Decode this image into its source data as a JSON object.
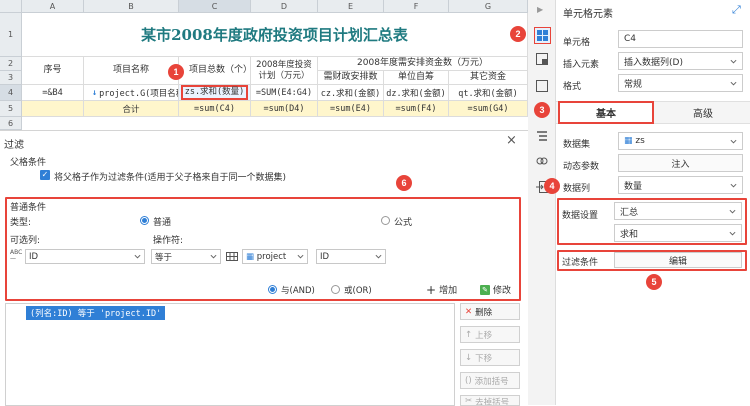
{
  "sheet": {
    "col_headers": [
      "A",
      "B",
      "C",
      "D",
      "E",
      "F",
      "G"
    ],
    "row_headers": [
      "1",
      "2",
      "3",
      "4",
      "5",
      "6"
    ],
    "title": "某市2008年度政府投资项目计划汇总表",
    "h_seq": "序号",
    "h_name": "项目名称",
    "h_total": "项目总数（个）",
    "h_plan": "2008年度投资计划（万元）",
    "h_arrange": "2008年度需安排资金数（万元）",
    "h_fiscal": "需财政安排数",
    "h_self": "单位自筹",
    "h_other": "其它资金",
    "r4_a": "=&B4",
    "r4_b": "project.G(项目名称)",
    "r4_c": "zs.求和(数量)",
    "r4_d": "=SUM(E4:G4)",
    "r4_e": "cz.求和(金额)",
    "r4_f": "dz.求和(金额)",
    "r4_g": "qt.求和(金额)",
    "r5_b": "合计",
    "r5_c": "=sum(C4)",
    "r5_d": "=sum(D4)",
    "r5_e": "=sum(E4)",
    "r5_f": "=sum(F4)",
    "r5_g": "=sum(G4)"
  },
  "callouts": [
    "1",
    "2",
    "3",
    "4",
    "5",
    "6"
  ],
  "dialog": {
    "title": "过滤",
    "parent_section": "父格条件",
    "parent_checkbox": "将父格子作为过滤条件(适用于父子格来自于同一个数据集)",
    "common_section": "普通条件",
    "type_label": "类型:",
    "type_normal": "普通",
    "type_formula": "公式",
    "optional_col_label": "可选列:",
    "operator_label": "操作符:",
    "col_value": "ID",
    "operator_value": "等于",
    "dataset_value": "project",
    "dataset_col_value": "ID",
    "logic_and": "与(AND)",
    "logic_or": "或(OR)",
    "add_button": "增加",
    "modify_button": "修改",
    "condition_text": "(列名:ID) 等于 'project.ID'",
    "delete_button": "删除",
    "up_button": "上移",
    "down_button": "下移",
    "add_bracket_button": "添加括号",
    "remove_bracket_button": "去掉括号"
  },
  "panel": {
    "title": "单元格元素",
    "cell_label": "单元格",
    "cell_value": "C4",
    "insert_label": "插入元素",
    "insert_value": "插入数据列(D)",
    "format_label": "格式",
    "format_value": "常规",
    "tab_basic": "基本",
    "tab_advanced": "高级",
    "dataset_label": "数据集",
    "dataset_value": "zs",
    "dynamic_label": "动态参数",
    "inject_button": "注入",
    "column_label": "数据列",
    "column_value": "数量",
    "setting_label": "数据设置",
    "setting_value1": "汇总",
    "setting_value2": "求和",
    "filter_label": "过滤条件",
    "edit_button": "编辑"
  },
  "colors": {
    "accent": "#e8443a",
    "blue": "#2f7fd6",
    "title_teal": "#1f7a80"
  }
}
